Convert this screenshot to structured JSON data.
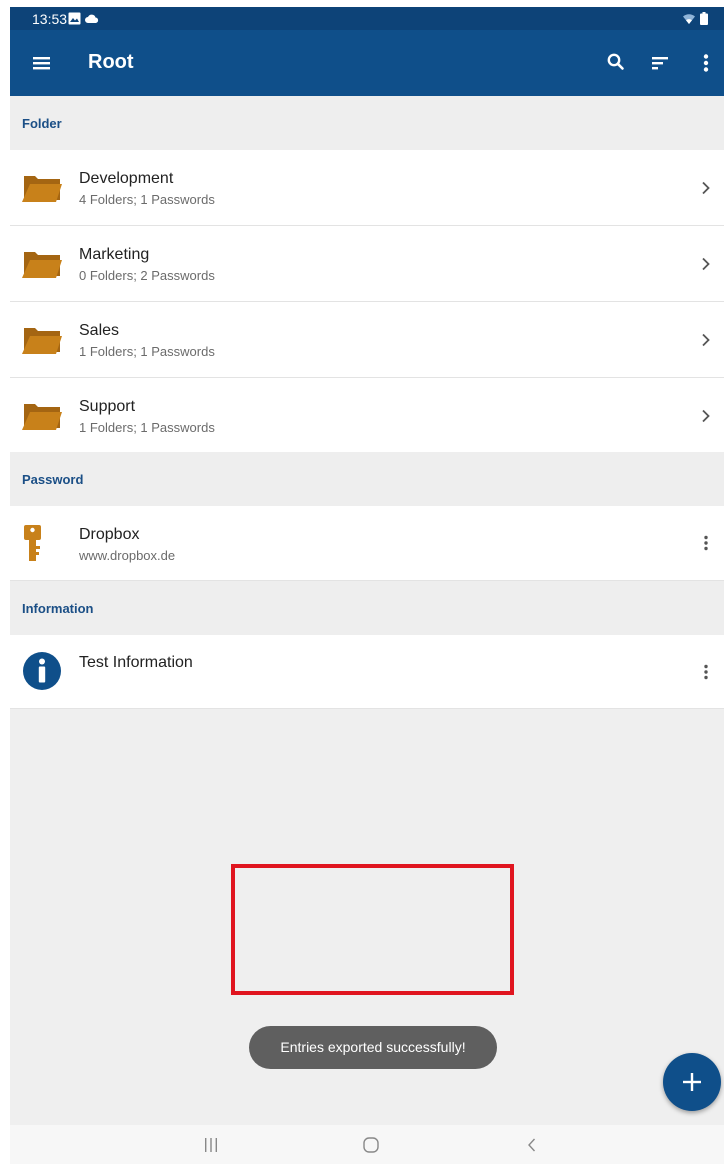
{
  "status_bar": {
    "time": "13:53",
    "icons": [
      "gallery-icon",
      "cloud-icon",
      "wifi-icon",
      "battery-icon"
    ]
  },
  "app_bar": {
    "title": "Root",
    "icons": [
      "menu-icon",
      "search-icon",
      "sort-icon",
      "more-vert-icon"
    ]
  },
  "sections": {
    "folder": {
      "header": "Folder",
      "items": [
        {
          "name": "Development",
          "detail": "4 Folders; 1 Passwords"
        },
        {
          "name": "Marketing",
          "detail": "0 Folders; 2 Passwords"
        },
        {
          "name": "Sales",
          "detail": "1 Folders; 1 Passwords"
        },
        {
          "name": "Support",
          "detail": "1 Folders; 1 Passwords"
        }
      ]
    },
    "password": {
      "header": "Password",
      "items": [
        {
          "name": "Dropbox",
          "detail": "www.dropbox.de"
        }
      ]
    },
    "information": {
      "header": "Information",
      "items": [
        {
          "name": "Test Information"
        }
      ]
    }
  },
  "toast": {
    "text": "Entries exported successfully!"
  },
  "fab": {
    "icon": "add-icon"
  },
  "nav_bar": {
    "icons": [
      "recent-apps-icon",
      "home-icon",
      "back-icon"
    ]
  },
  "colors": {
    "primary": "#0f4f8a",
    "status_bar": "#0d4378",
    "folder": "#c8811a",
    "highlight": "#e0151f",
    "toast": "#5f5f5f"
  }
}
